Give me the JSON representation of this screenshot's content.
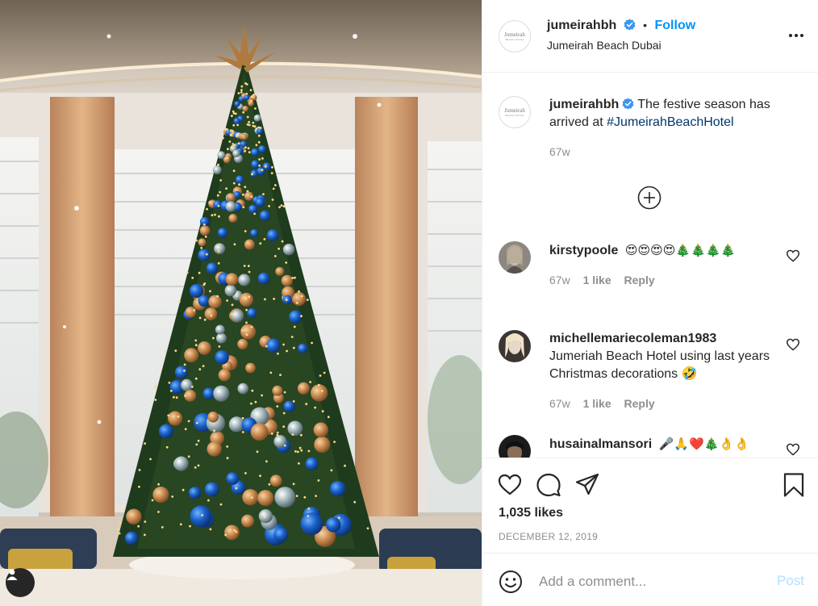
{
  "post": {
    "author": "jumeirahbh",
    "author_location": "Jumeirah Beach Dubai",
    "follow_label": "Follow",
    "separator": "•",
    "avatar_text": "Jumeirah",
    "avatar_subtext": "BEACH HOTEL",
    "photo_alt": "Christmas tree decorated with blue and gold ornaments",
    "caption": {
      "username": "jumeirahbh",
      "text": "The festive season has arrived at ",
      "hashtag": "#JumeirahBeachHotel",
      "age": "67w"
    },
    "likes": "1,035 likes",
    "date": "DECEMBER 12, 2019"
  },
  "comments": [
    {
      "username": "kirstypoole",
      "text": "😍😍😍😍🎄🎄🎄🎄",
      "age": "67w",
      "likes": "1 like",
      "reply": "Reply"
    },
    {
      "username": "michellemariecoleman1983",
      "text": "Jumeriah Beach Hotel using last years Christmas decorations 🤣",
      "age": "67w",
      "likes": "1 like",
      "reply": "Reply"
    },
    {
      "username": "husainalmansori",
      "text": "🎤🙏❤️🎄👌👌"
    }
  ],
  "add_comment": {
    "placeholder": "Add a comment...",
    "post_label": "Post"
  },
  "icons": {
    "more": "more-horizontal-icon",
    "verified": "verified-badge-icon",
    "load_more": "plus-circle-icon",
    "like": "heart-outline-icon",
    "comment": "comment-bubble-icon",
    "share": "paper-plane-icon",
    "save": "bookmark-icon",
    "emoji": "smiley-face-icon",
    "user_tag": "user-tag-icon"
  },
  "colors": {
    "link_blue": "#0095f6",
    "hashtag_blue": "#00376b",
    "muted_text": "#8e8e8e",
    "post_disabled": "#b2dffc",
    "verified_blue": "#3897f0"
  }
}
